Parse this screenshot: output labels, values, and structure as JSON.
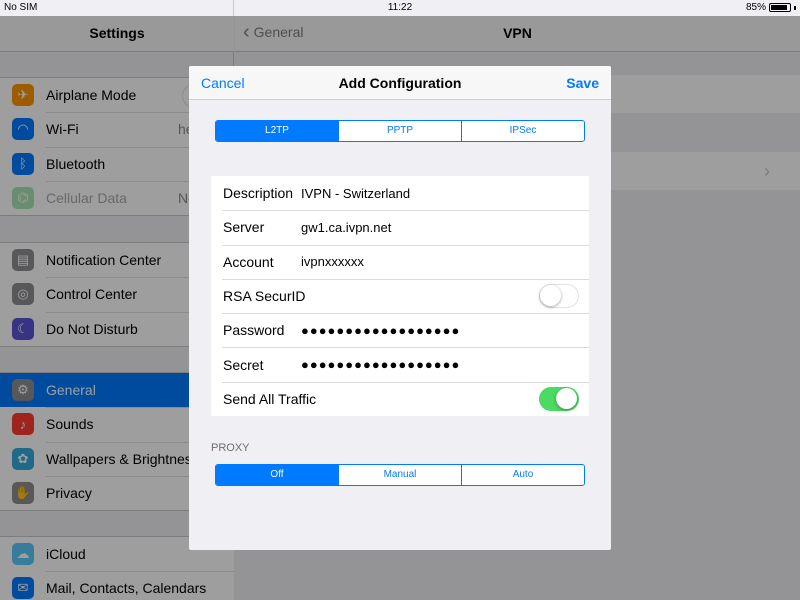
{
  "status_bar": {
    "carrier": "No SIM",
    "time": "11:22",
    "battery": "85%"
  },
  "settings_panel": {
    "title": "Settings",
    "groups": [
      [
        {
          "label": "Airplane Mode",
          "icon": "airplane-icon",
          "color": "#ff9500",
          "glyph": "✈",
          "value": ""
        },
        {
          "label": "Wi-Fi",
          "icon": "wifi-icon",
          "color": "#007aff",
          "glyph": "◠",
          "value": "he"
        },
        {
          "label": "Bluetooth",
          "icon": "bluetooth-icon",
          "color": "#007aff",
          "glyph": "ᛒ",
          "value": ""
        },
        {
          "label": "Cellular Data",
          "icon": "cellular-icon",
          "color": "#4cd964",
          "glyph": "⌬",
          "value": "No"
        }
      ],
      [
        {
          "label": "Notification Center",
          "icon": "notification-center-icon",
          "color": "#8e8e93",
          "glyph": "▤",
          "value": ""
        },
        {
          "label": "Control Center",
          "icon": "control-center-icon",
          "color": "#8e8e93",
          "glyph": "◎",
          "value": ""
        },
        {
          "label": "Do Not Disturb",
          "icon": "moon-icon",
          "color": "#5856d6",
          "glyph": "☾",
          "value": ""
        }
      ],
      [
        {
          "label": "General",
          "icon": "gear-icon",
          "color": "#8e8e93",
          "glyph": "⚙",
          "value": ""
        },
        {
          "label": "Sounds",
          "icon": "speaker-icon",
          "color": "#ff3b30",
          "glyph": "♪",
          "value": ""
        },
        {
          "label": "Wallpapers & Brightness",
          "icon": "flower-icon",
          "color": "#34aadc",
          "glyph": "✿",
          "value": ""
        },
        {
          "label": "Privacy",
          "icon": "hand-icon",
          "color": "#8e8e93",
          "glyph": "✋",
          "value": ""
        }
      ],
      [
        {
          "label": "iCloud",
          "icon": "cloud-icon",
          "color": "#5ac8fa",
          "glyph": "☁",
          "value": ""
        },
        {
          "label": "Mail, Contacts, Calendars",
          "icon": "mail-icon",
          "color": "#007aff",
          "glyph": "✉",
          "value": ""
        }
      ]
    ]
  },
  "detail": {
    "back_label": "General",
    "title": "VPN"
  },
  "modal": {
    "cancel": "Cancel",
    "title": "Add Configuration",
    "save": "Save",
    "type_segments": [
      "L2TP",
      "PPTP",
      "IPSec"
    ],
    "selected_type": "L2TP",
    "fields": {
      "description": {
        "label": "Description",
        "value": "IVPN - Switzerland"
      },
      "server": {
        "label": "Server",
        "value": "gw1.ca.ivpn.net"
      },
      "account": {
        "label": "Account",
        "value": "ivpnxxxxxx"
      },
      "rsa": {
        "label": "RSA SecurID",
        "on": false
      },
      "password": {
        "label": "Password",
        "value": "●●●●●●●●●●●●●●●●●●"
      },
      "secret": {
        "label": "Secret",
        "value": "●●●●●●●●●●●●●●●●●●"
      },
      "send_all": {
        "label": "Send All Traffic",
        "on": true
      }
    },
    "proxy_label": "PROXY",
    "proxy_segments": [
      "Off",
      "Manual",
      "Auto"
    ],
    "selected_proxy": "Off"
  },
  "colors": {
    "accent": "#007aff",
    "toggle_on": "#4cd964"
  }
}
